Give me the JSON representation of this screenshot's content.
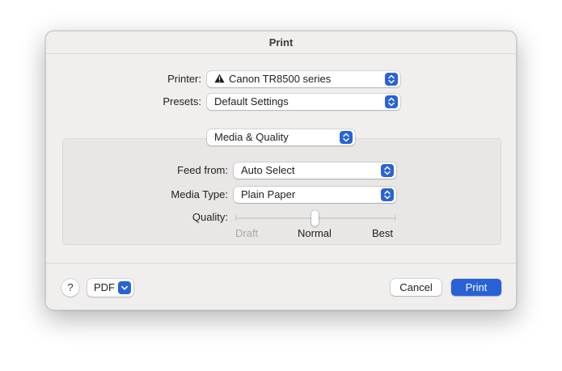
{
  "window": {
    "title": "Print"
  },
  "printer": {
    "label": "Printer:",
    "value": "Canon TR8500 series",
    "status_icon": "warning-icon"
  },
  "presets": {
    "label": "Presets:",
    "value": "Default Settings"
  },
  "pane_selector": {
    "value": "Media & Quality"
  },
  "feed_from": {
    "label": "Feed from:",
    "value": "Auto Select"
  },
  "media_type": {
    "label": "Media Type:",
    "value": "Plain Paper"
  },
  "quality": {
    "label": "Quality:",
    "ticks": [
      "Draft",
      "Normal",
      "Best"
    ],
    "selected": "Normal",
    "disabled_ticks": [
      "Draft"
    ]
  },
  "footer": {
    "help_label": "?",
    "pdf_label": "PDF",
    "cancel_label": "Cancel",
    "print_label": "Print"
  },
  "colors": {
    "accent": "#2962d6",
    "dialog_background": "#f1efee",
    "section_background": "#e9e7e6",
    "disabled_text": "#a9a9a9"
  }
}
